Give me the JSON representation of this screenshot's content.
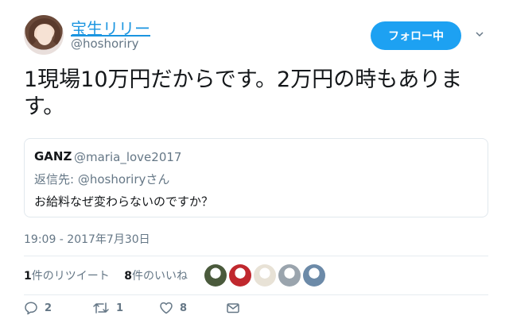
{
  "author": {
    "display_name": "宝生リリー",
    "handle": "@hoshoriry"
  },
  "follow_button": {
    "label": "フォロー中",
    "color": "#1da1f2"
  },
  "tweet": {
    "text": "1現場10万円だからです。2万円の時もあります。"
  },
  "quoted_tweet": {
    "name": "GANZ",
    "handle": "@maria_love2017",
    "reply_prefix": "返信先: ",
    "reply_to": "@hoshoriry",
    "reply_suffix": "さん",
    "text": "お給料なぜ変わらないのですか？"
  },
  "timestamp": "19:09 - 2017年7月30日",
  "stats": {
    "retweets_count": "1",
    "retweets_label": "件のリツイート",
    "likes_count": "8",
    "likes_label": "件のいいね"
  },
  "liker_avatars": [
    "#4a5a3c",
    "#c0282e",
    "#e8e2d6",
    "#9aa4ad",
    "#6c8aa8"
  ],
  "actions": {
    "reply_count": "2",
    "retweet_count": "1",
    "like_count": "8",
    "icons": [
      "reply-icon",
      "retweet-icon",
      "like-icon",
      "message-icon"
    ]
  },
  "colors": {
    "link": "#1b95e0",
    "muted": "#657786",
    "text": "#14171a"
  }
}
